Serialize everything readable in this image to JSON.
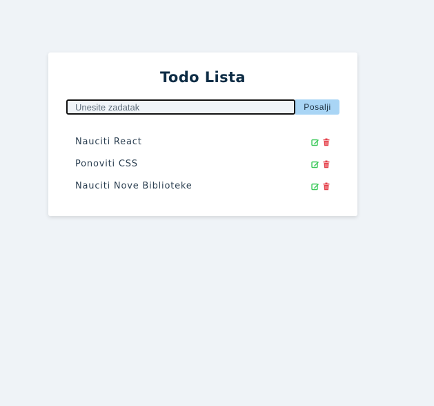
{
  "app": {
    "title": "Todo Lista"
  },
  "form": {
    "placeholder": "Unesite zadatak",
    "value": "",
    "submit_label": "Posalji"
  },
  "todos": [
    {
      "text": "Nauciti React",
      "edit_icon": "edit-icon",
      "delete_icon": "trash-icon"
    },
    {
      "text": "Ponoviti CSS",
      "edit_icon": "edit-icon",
      "delete_icon": "trash-icon"
    },
    {
      "text": "Nauciti Nove Biblioteke",
      "edit_icon": "edit-icon",
      "delete_icon": "trash-icon"
    }
  ],
  "colors": {
    "background": "#eff3f7",
    "card": "#ffffff",
    "title": "#0d2c45",
    "button": "#a9d5f5",
    "edit_icon": "#3cc95a",
    "delete_icon": "#e5404a"
  }
}
